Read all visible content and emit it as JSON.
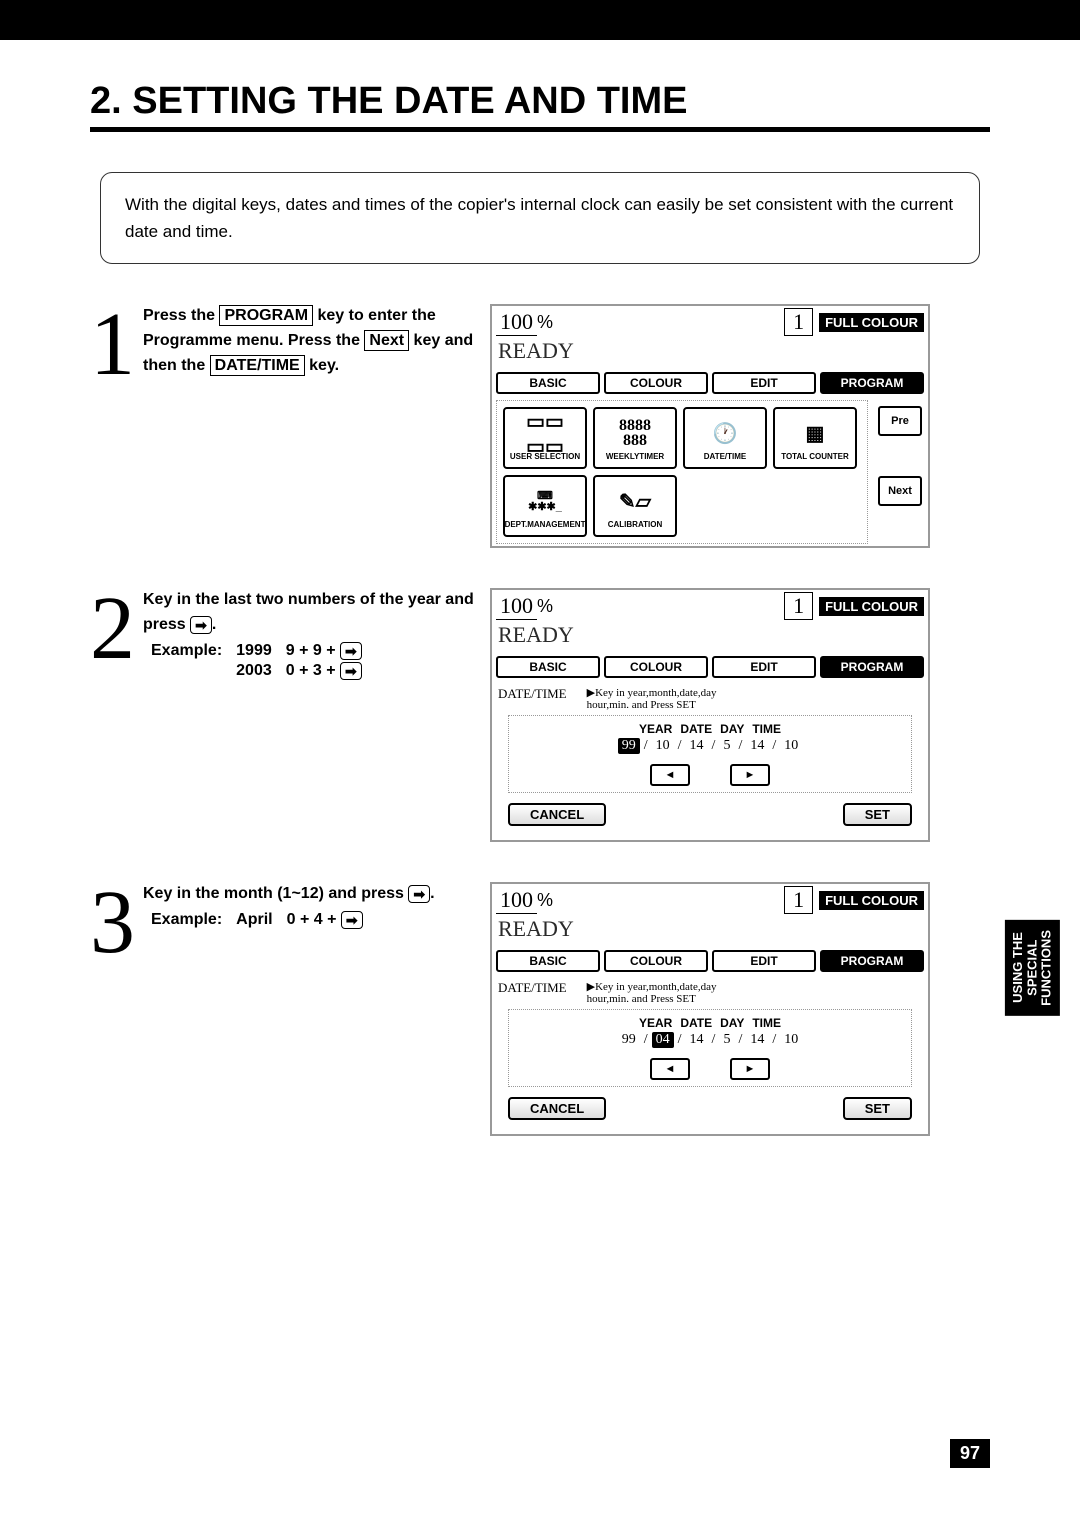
{
  "section_number": "2.",
  "section_title": "SETTING THE DATE AND TIME",
  "intro": "With the digital keys, dates and times of the copier's internal clock can easily be set consistent with the current date and time.",
  "steps": {
    "s1": {
      "num": "1",
      "t1": "Press the ",
      "k1": "PROGRAM",
      "t2": " key to enter the Programme menu.  Press the ",
      "k2": "Next",
      "t3": " key and then the ",
      "k3": "DATE/TIME",
      "t4": " key."
    },
    "s2": {
      "num": "2",
      "t1": "Key in the last two numbers of the year and press ",
      "t2": ".",
      "ex_label": "Example:",
      "ex1_y": "1999",
      "ex1_k": "9 + 9 + ",
      "ex2_y": "2003",
      "ex2_k": "0 + 3 + "
    },
    "s3": {
      "num": "3",
      "t1": "Key in the month (1~12) and press ",
      "t2": ".",
      "ex_label": "Example:",
      "ex_m": "April",
      "ex_k": "0 + 4 + "
    }
  },
  "screen_common": {
    "pct": "100",
    "pct_sign": "%",
    "copies": "1",
    "mode": "FULL COLOUR",
    "ready": "READY",
    "tabs": {
      "basic": "BASIC",
      "colour": "COLOUR",
      "edit": "EDIT",
      "program": "PROGRAM"
    }
  },
  "screen1": {
    "cells": {
      "user_selection": "USER SELECTION",
      "weekly_timer": "WEEKLYTIMER",
      "date_time": "DATE/TIME",
      "total_counter": "TOTAL COUNTER",
      "dept_mgmt": "DEPT.MANAGEMENT",
      "calibration": "CALIBRATION"
    },
    "pre": "Pre",
    "next": "Next",
    "weekly_digits": "8888\n888",
    "dept_symbols": "⌨\n✱✱✱_"
  },
  "screen2": {
    "panel_label": "DATE/TIME",
    "hint1": "▶Key in year,month,date,day",
    "hint2": "hour,min. and Press SET",
    "headers": {
      "y": "YEAR",
      "d": "DATE",
      "dy": "DAY",
      "t": "TIME"
    },
    "vals": {
      "y": "99",
      "mo": "10",
      "d": "14",
      "dy": "5",
      "h": "14",
      "mi": "10"
    },
    "cancel": "CANCEL",
    "set": "SET"
  },
  "screen3": {
    "panel_label": "DATE/TIME",
    "hint1": "▶Key in year,month,date,day",
    "hint2": "hour,min. and Press SET",
    "headers": {
      "y": "YEAR",
      "d": "DATE",
      "dy": "DAY",
      "t": "TIME"
    },
    "vals": {
      "y": "99",
      "mo": "04",
      "d": "14",
      "dy": "5",
      "h": "14",
      "mi": "10"
    },
    "cancel": "CANCEL",
    "set": "SET"
  },
  "side_tab": "USING THE\nSPECIAL\nFUNCTIONS",
  "page_number": "97"
}
